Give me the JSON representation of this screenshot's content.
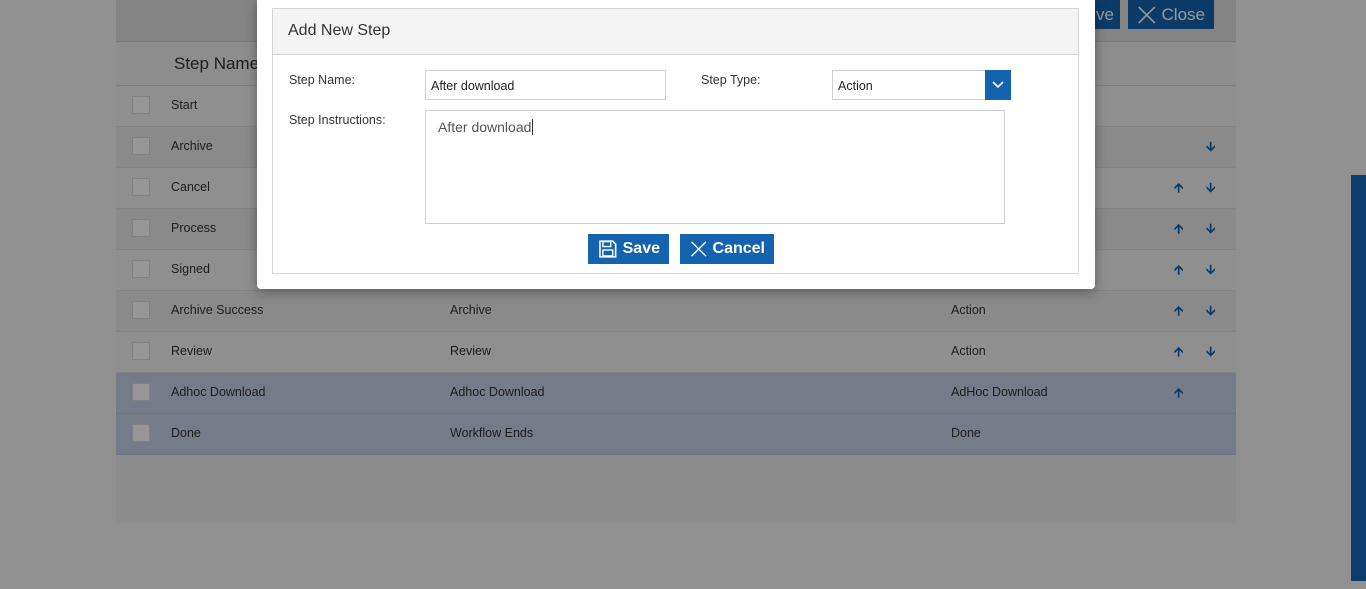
{
  "toolbar": {
    "save_partial_label": "ve",
    "close_label": "Close"
  },
  "table": {
    "header_step_name": "Step Name",
    "rows": [
      {
        "name": "Start",
        "instruction": "",
        "type": "",
        "up": false,
        "down": false
      },
      {
        "name": "Archive",
        "instruction": "",
        "type": "",
        "up": false,
        "down": true
      },
      {
        "name": "Cancel",
        "instruction": "",
        "type": "",
        "up": true,
        "down": true
      },
      {
        "name": "Process",
        "instruction": "",
        "type": "",
        "up": true,
        "down": true
      },
      {
        "name": "Signed",
        "instruction": "",
        "type": "",
        "up": true,
        "down": true
      },
      {
        "name": "Archive Success",
        "instruction": "Archive",
        "type": "Action",
        "up": true,
        "down": true
      },
      {
        "name": "Review",
        "instruction": "Review",
        "type": "Action",
        "up": true,
        "down": true
      },
      {
        "name": "Adhoc Download",
        "instruction": "Adhoc Download",
        "type": "AdHoc Download",
        "up": true,
        "down": false
      },
      {
        "name": "Done",
        "instruction": "Workflow Ends",
        "type": "Done",
        "up": false,
        "down": false
      }
    ]
  },
  "modal": {
    "title": "Add New Step",
    "step_name_label": "Step Name:",
    "step_name_value": "After download",
    "step_type_label": "Step Type:",
    "step_type_value": "Action",
    "instructions_label": "Step Instructions:",
    "instructions_value": "After download",
    "save_label": "Save",
    "cancel_label": "Cancel"
  },
  "icons": {
    "up_arrow": "arrow-up-icon",
    "down_arrow": "arrow-down-icon",
    "save": "floppy-disk-icon",
    "close": "close-icon",
    "dropdown": "chevron-down-icon"
  },
  "colors": {
    "accent": "#1463ae",
    "selected_row": "#c5cde6"
  }
}
